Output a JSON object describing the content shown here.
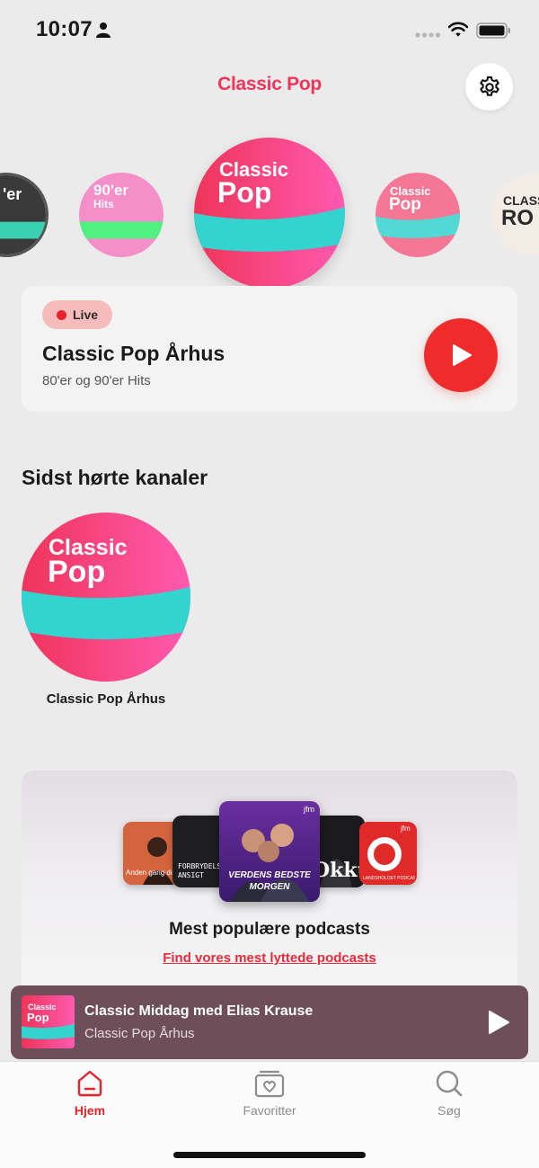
{
  "status_bar": {
    "time": "10:07"
  },
  "header": {
    "title": "Classic Pop"
  },
  "carousel": {
    "stations": [
      {
        "logo_line1": "'er",
        "logo_line2": ""
      },
      {
        "logo_line1": "90'er",
        "logo_line2": "Hits"
      },
      {
        "logo_line1": "Classic",
        "logo_line2": "Pop"
      },
      {
        "logo_line1": "Classic",
        "logo_line2": "Pop"
      },
      {
        "logo_line1": "CLASS",
        "logo_line2": "RO"
      }
    ]
  },
  "now_playing": {
    "badge": "Live",
    "name": "Classic Pop Århus",
    "subtitle": "80'er og 90'er Hits"
  },
  "recent": {
    "title": "Sidst hørte kanaler",
    "items": [
      {
        "logo_line1": "Classic",
        "logo_line2": "Pop",
        "label": "Classic Pop Århus"
      }
    ]
  },
  "podcasts": {
    "title": "Mest populære podcasts",
    "link": "Find vores mest lyttede podcasts",
    "covers": [
      {
        "text": "Anden gang du..."
      },
      {
        "text": "FORBRYDELSENS ANSIGT"
      },
      {
        "text": "VERDENS BEDSTE MORGEN",
        "brand": "jfm"
      },
      {
        "text": "Okkult"
      },
      {
        "text": "LANDSHOLDET PODCAST",
        "brand": "jfm"
      }
    ]
  },
  "mini_player": {
    "logo_line1": "Classic",
    "logo_line2": "Pop",
    "title": "Classic Middag med Elias Krause",
    "subtitle": "Classic Pop Århus"
  },
  "tabs": [
    {
      "label": "Hjem",
      "icon": "home-icon",
      "active": true
    },
    {
      "label": "Favoritter",
      "icon": "heart-box-icon",
      "active": false
    },
    {
      "label": "Søg",
      "icon": "search-icon",
      "active": false
    }
  ],
  "colors": {
    "brand_pink": "#f0345a",
    "accent_red": "#ef2b2b",
    "teal": "#33d3cf",
    "mini_player_bg": "#6e4f59"
  }
}
